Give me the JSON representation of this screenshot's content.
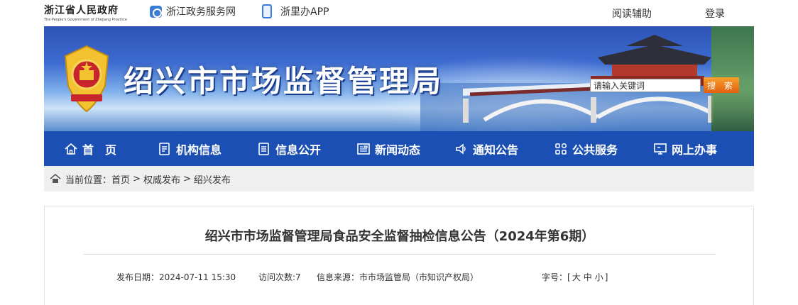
{
  "topbar": {
    "gov_name": "浙江省人民政府",
    "gov_name_en": "The People's Government of Zhejiang Province",
    "links": [
      "浙江政务服务网",
      "浙里办APP"
    ],
    "accessibility": "阅读辅助",
    "login": "登录"
  },
  "banner": {
    "title": "绍兴市市场监督管理局",
    "search_placeholder": "请输入关键词",
    "search_button": "搜 索"
  },
  "nav": {
    "items": [
      "首　页",
      "机构信息",
      "信息公开",
      "新闻动态",
      "通知公告",
      "公共服务",
      "网上办事"
    ]
  },
  "breadcrumb": {
    "prefix": "当前位置：",
    "items": [
      "首页",
      "权威发布",
      "绍兴发布"
    ],
    "separator": ">"
  },
  "article": {
    "title": "绍兴市市场监督管理局食品安全监督抽检信息公告（2024年第6期）",
    "publish_label": "发布日期：",
    "publish_date": "2024-07-11 15:30",
    "visits_label": "访问次数:",
    "visits": "7",
    "source_label": "信息来源：",
    "source": "市市场监管局（市知识产权局）",
    "font_size_label": "字号：[",
    "font_sizes": [
      "大",
      "中",
      "小"
    ],
    "font_size_close": "]"
  },
  "colors": {
    "nav_bg": "#1b4fb3",
    "search_button": "#e2600e",
    "breadcrumb_bg": "#efefef"
  }
}
